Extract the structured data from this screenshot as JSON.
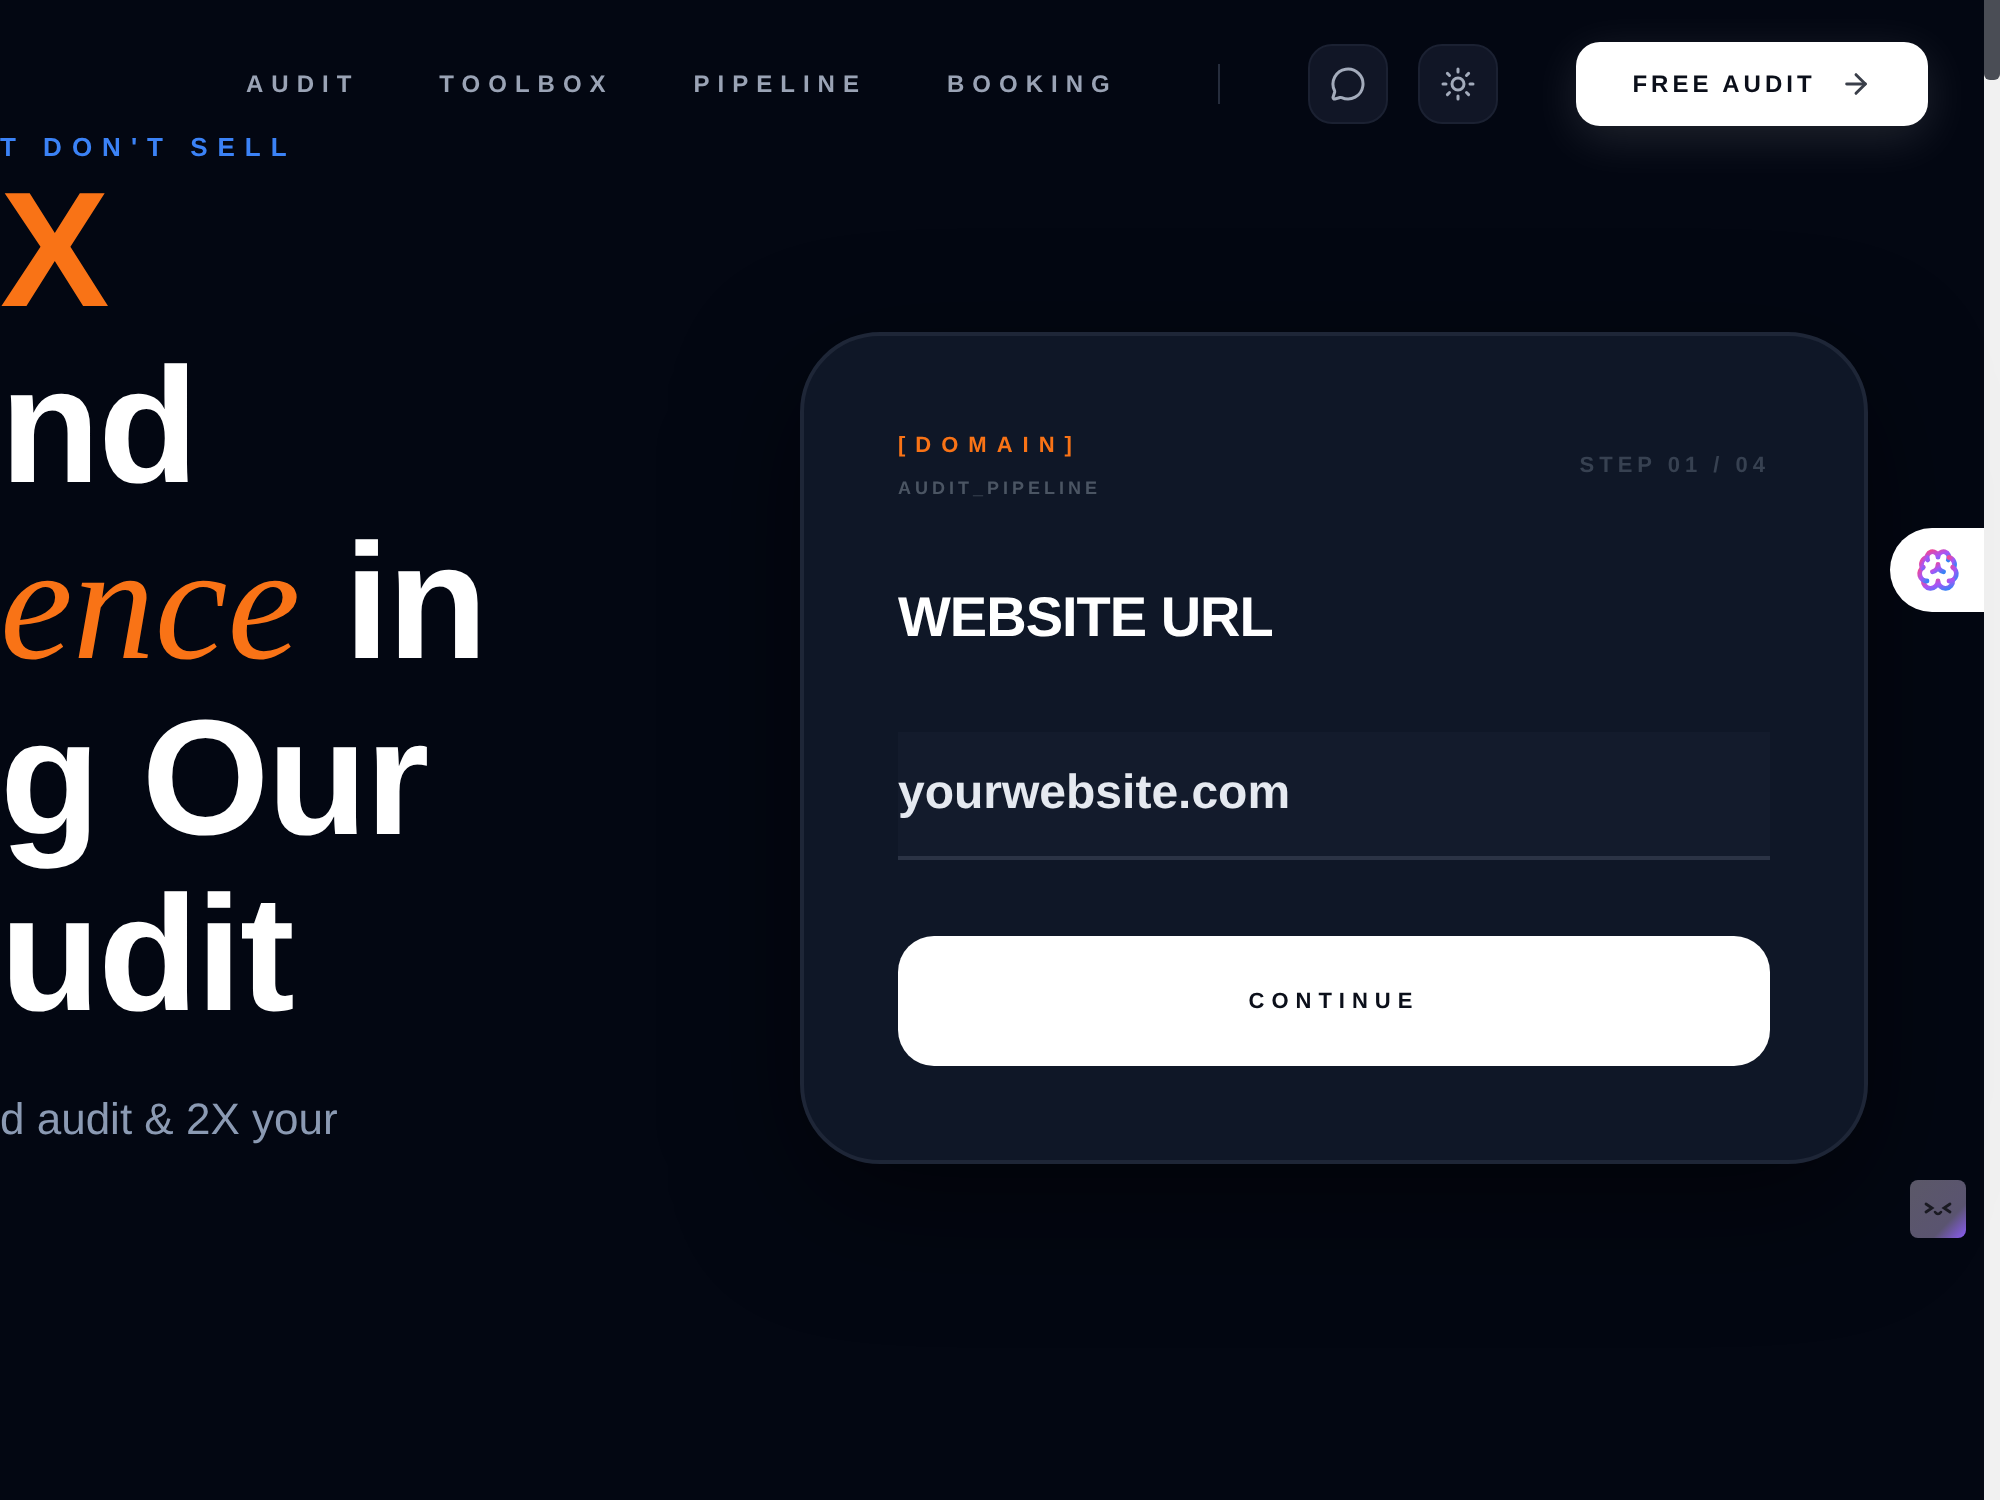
{
  "nav": {
    "links": [
      {
        "label": "AUDIT"
      },
      {
        "label": "TOOLBOX"
      },
      {
        "label": "PIPELINE"
      },
      {
        "label": "BOOKING"
      }
    ],
    "cta": "FREE AUDIT"
  },
  "hero": {
    "eyebrow": "T DON'T SELL",
    "heading": [
      [
        {
          "text": "X",
          "kind": "accent"
        }
      ],
      [
        {
          "text": "nd",
          "kind": "plain"
        }
      ],
      [
        {
          "text": "ence",
          "kind": "script"
        },
        {
          "text": "in",
          "kind": "plain"
        }
      ],
      [
        {
          "text": "g Our",
          "kind": "plain"
        }
      ],
      [
        {
          "text": "udit",
          "kind": "plain"
        }
      ]
    ],
    "subtitle": "d audit & 2X your"
  },
  "card": {
    "tag": "[DOMAIN]",
    "subtag": "AUDIT_PIPELINE",
    "step": "STEP 01 / 04",
    "title": "WEBSITE URL",
    "input": {
      "value": "yourwebsite.com"
    },
    "button": "CONTINUE"
  }
}
